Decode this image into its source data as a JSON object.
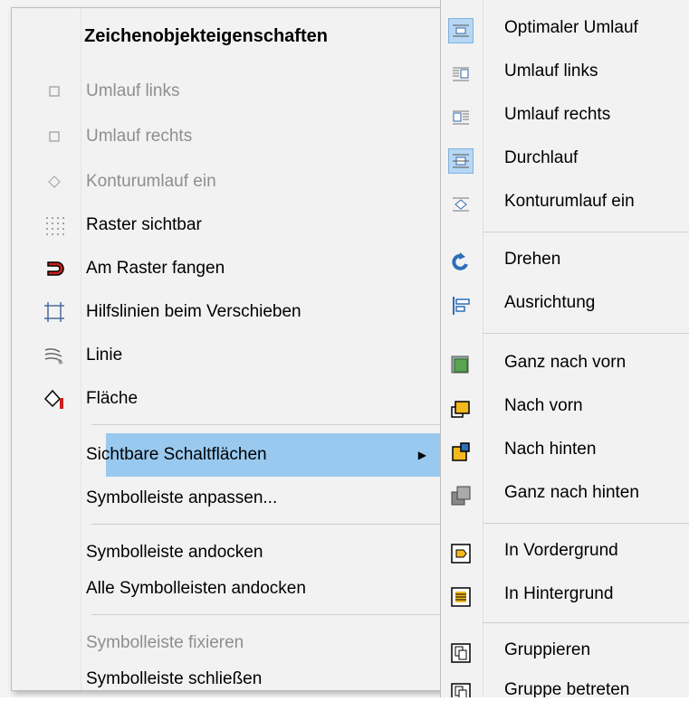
{
  "menu": {
    "title": "Zeichenobjekteigenschaften",
    "items": [
      {
        "label": "Umlauf links",
        "icon": "wrap-left-small-icon",
        "disabled": true
      },
      {
        "label": "Umlauf rechts",
        "icon": "wrap-right-small-icon",
        "disabled": true
      },
      {
        "label": "Konturumlauf ein",
        "icon": "contour-diamond-icon",
        "disabled": true
      },
      {
        "label": "Raster sichtbar",
        "icon": "grid-dots-icon",
        "disabled": false
      },
      {
        "label": "Am Raster fangen",
        "icon": "magnet-icon",
        "disabled": false
      },
      {
        "label": "Hilfslinien beim Verschieben",
        "icon": "helplines-icon",
        "disabled": false
      },
      {
        "label": "Linie",
        "icon": "line-icon",
        "disabled": false
      },
      {
        "label": "Fläche",
        "icon": "paint-bucket-icon",
        "disabled": false
      },
      {
        "label": "Sichtbare Schaltflächen",
        "highlighted": true,
        "submenu": true
      },
      {
        "label": "Symbolleiste anpassen..."
      },
      {
        "label": "Symbolleiste andocken"
      },
      {
        "label": "Alle Symbolleisten andocken"
      },
      {
        "label": "Symbolleiste fixieren",
        "disabled": true
      },
      {
        "label": "Symbolleiste schließen"
      }
    ]
  },
  "submenu": {
    "items": [
      {
        "label": "Optimaler Umlauf",
        "icon": "wrap-optimal-icon",
        "active": true
      },
      {
        "label": "Umlauf links",
        "icon": "wrap-left-icon",
        "active": false
      },
      {
        "label": "Umlauf rechts",
        "icon": "wrap-right-icon",
        "active": false
      },
      {
        "label": "Durchlauf",
        "icon": "wrap-through-icon",
        "active": true
      },
      {
        "label": "Konturumlauf ein",
        "icon": "wrap-contour-icon",
        "active": false
      },
      {
        "label": "Drehen",
        "icon": "rotate-icon",
        "active": false
      },
      {
        "label": "Ausrichtung",
        "icon": "align-icon",
        "active": false
      },
      {
        "label": "Ganz nach vorn",
        "icon": "bring-to-front-icon",
        "active": false
      },
      {
        "label": "Nach vorn",
        "icon": "bring-forward-icon",
        "active": false
      },
      {
        "label": "Nach hinten",
        "icon": "send-backward-icon",
        "active": false
      },
      {
        "label": "Ganz nach hinten",
        "icon": "send-to-back-icon",
        "active": false
      },
      {
        "label": "In Vordergrund",
        "icon": "to-foreground-icon",
        "active": false
      },
      {
        "label": "In Hintergrund",
        "icon": "to-background-icon",
        "active": false
      },
      {
        "label": "Gruppieren",
        "icon": "group-icon",
        "active": false
      },
      {
        "label": "Gruppe betreten",
        "icon": "enter-group-icon",
        "active": false
      }
    ]
  },
  "colors": {
    "highlight": "#99c9ef",
    "menu_bg": "#f2f2f2",
    "disabled_text": "#8e8e8e"
  }
}
